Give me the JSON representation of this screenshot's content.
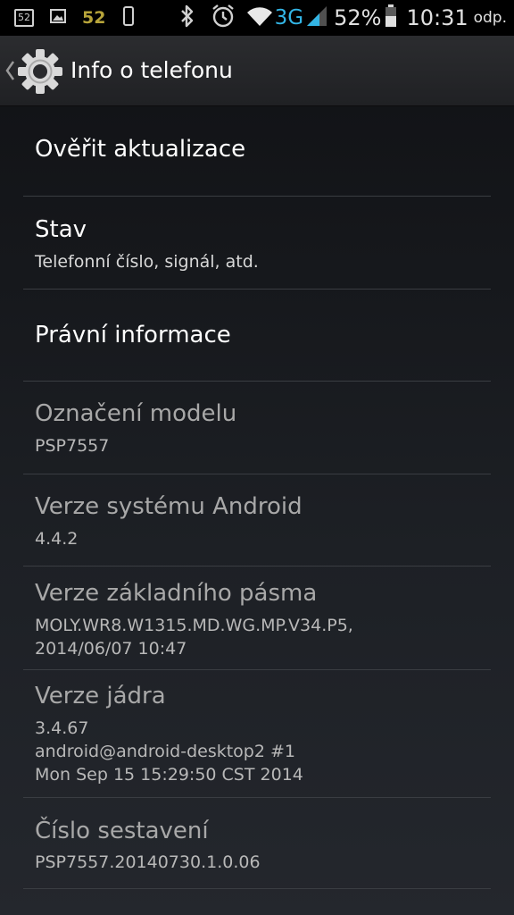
{
  "status_bar": {
    "sms_count": "52",
    "notification_number": "52",
    "network_type": "3G",
    "battery_percent": "52%",
    "time": "10:31",
    "ampm": "odp.",
    "icons": [
      "sms-icon",
      "image-icon",
      "phone-icon",
      "bluetooth-icon",
      "alarm-icon",
      "wifi-icon",
      "signal-icon",
      "battery-icon"
    ]
  },
  "action_bar": {
    "title": "Info o telefonu",
    "icon": "settings-gear-icon"
  },
  "items": [
    {
      "title": "Ověřit aktualizace",
      "summary": "",
      "enabled": true
    },
    {
      "title": "Stav",
      "summary": "Telefonní číslo, signál, atd.",
      "enabled": true
    },
    {
      "title": "Právní informace",
      "summary": "",
      "enabled": true
    },
    {
      "title": "Označení modelu",
      "summary": "PSP7557",
      "enabled": false
    },
    {
      "title": "Verze systému Android",
      "summary": "4.4.2",
      "enabled": false
    },
    {
      "title": "Verze základního pásma",
      "summary": "MOLY.WR8.W1315.MD.WG.MP.V34.P5,\n2014/06/07 10:47",
      "enabled": false
    },
    {
      "title": "Verze jádra",
      "summary": "3.4.67\nandroid@android-desktop2 #1\nMon Sep 15 15:29:50 CST 2014",
      "enabled": false
    },
    {
      "title": "Číslo sestavení",
      "summary": "PSP7557.20140730.1.0.06",
      "enabled": false
    }
  ],
  "colors": {
    "accent": "#33b5e5",
    "badge": "#b7a43a",
    "title_enabled": "#ffffff",
    "title_disabled": "#a8a8a8"
  }
}
